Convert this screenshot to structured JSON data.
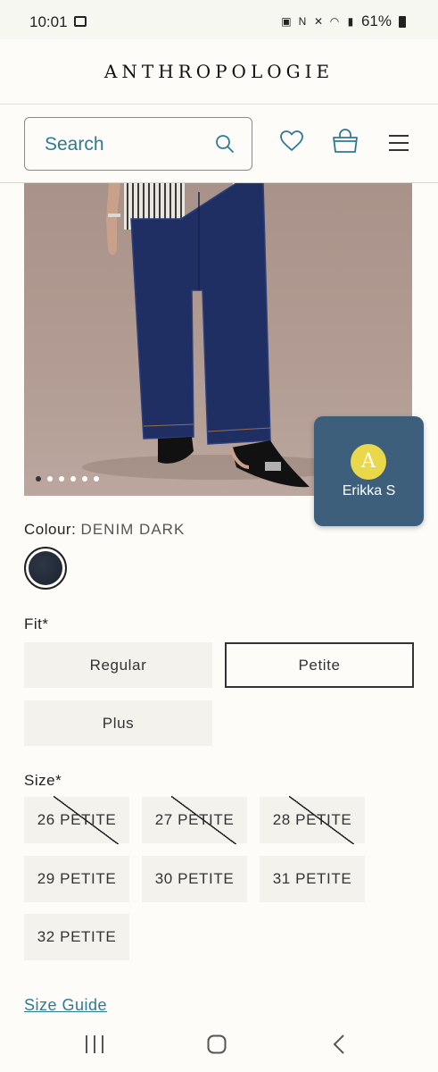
{
  "status_bar": {
    "time": "10:01",
    "battery": "61%"
  },
  "header": {
    "brand": "ANTHROPOLOGIE",
    "search_placeholder": "Search",
    "icons": [
      "wishlist-heart-icon",
      "shopping-bag-icon",
      "hamburger-menu-icon"
    ],
    "accent_color": "#2f7a93"
  },
  "product": {
    "image_dots_count": 6,
    "image_dot_active": 0
  },
  "chat": {
    "avatar_initial": "A",
    "agent_name": "Erikka S",
    "bg_color": "#3e5f7c"
  },
  "colour": {
    "label": "Colour:",
    "value": "DENIM DARK"
  },
  "fit": {
    "label": "Fit*",
    "options": [
      "Regular",
      "Petite",
      "Plus"
    ],
    "selected": "Petite"
  },
  "size": {
    "label": "Size*",
    "options": [
      {
        "label": "26 PETITE",
        "available": false
      },
      {
        "label": "27 PETITE",
        "available": false
      },
      {
        "label": "28 PETITE",
        "available": false
      },
      {
        "label": "29 PETITE",
        "available": true
      },
      {
        "label": "30 PETITE",
        "available": true
      },
      {
        "label": "31 PETITE",
        "available": true
      },
      {
        "label": "32 PETITE",
        "available": true
      }
    ]
  },
  "size_guide": "Size Guide"
}
